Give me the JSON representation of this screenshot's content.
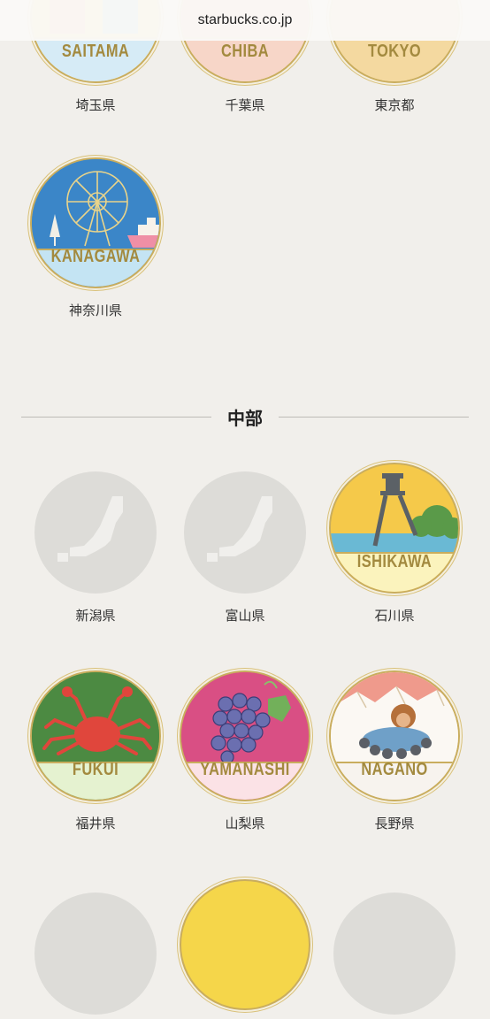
{
  "browser": {
    "url": "starbucks.co.jp"
  },
  "section_chubu": {
    "title": "中部"
  },
  "badges": {
    "saitama": {
      "name": "SAITAMA",
      "caption": "埼玉県"
    },
    "chiba": {
      "name": "CHIBA",
      "caption": "千葉県"
    },
    "tokyo": {
      "name": "TOKYO",
      "caption": "東京都"
    },
    "kanagawa": {
      "name": "KANAGAWA",
      "caption": "神奈川県"
    },
    "niigata": {
      "caption": "新潟県"
    },
    "toyama": {
      "caption": "富山県"
    },
    "ishikawa": {
      "name": "ISHIKAWA",
      "caption": "石川県"
    },
    "fukui": {
      "name": "FUKUI",
      "caption": "福井県"
    },
    "yamanashi": {
      "name": "YAMANASHI",
      "caption": "山梨県"
    },
    "nagano": {
      "name": "NAGANO",
      "caption": "長野県"
    }
  },
  "colors": {
    "background": "#f1efeb",
    "gold": "#a38a3f",
    "placeholder": "#dddcd8"
  }
}
